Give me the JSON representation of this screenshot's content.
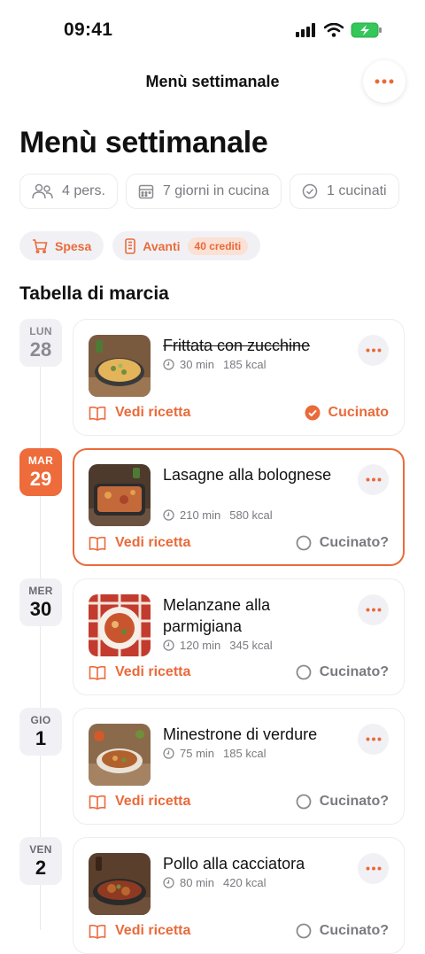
{
  "status_bar": {
    "time": "09:41"
  },
  "nav": {
    "title": "Menù settimanale"
  },
  "page": {
    "title": "Menù settimanale"
  },
  "chips": [
    {
      "label": "4 pers.",
      "icon": "people-icon"
    },
    {
      "label": "7 giorni in cucina",
      "icon": "calendar-icon"
    },
    {
      "label": "1 cucinati",
      "icon": "check-circle-icon"
    }
  ],
  "actions": {
    "shopping_label": "Spesa",
    "next_label": "Avanti",
    "credits_label": "40 crediti"
  },
  "section": {
    "title": "Tabella di marcia"
  },
  "days": [
    {
      "weekday": "LUN",
      "day": "28",
      "title": "Frittata con zucchine",
      "time": "30 min",
      "kcal": "185 kcal",
      "recipe_label": "Vedi ricetta",
      "status_label": "Cucinato",
      "cooked": true
    },
    {
      "weekday": "MAR",
      "day": "29",
      "title": "Lasagne alla bolognese",
      "time": "210 min",
      "kcal": "580 kcal",
      "recipe_label": "Vedi ricetta",
      "status_label": "Cucinato?",
      "cooked": false
    },
    {
      "weekday": "MER",
      "day": "30",
      "title": "Melanzane alla parmigiana",
      "time": "120 min",
      "kcal": "345 kcal",
      "recipe_label": "Vedi ricetta",
      "status_label": "Cucinato?",
      "cooked": false
    },
    {
      "weekday": "GIO",
      "day": "1",
      "title": "Minestrone di verdure",
      "time": "75 min",
      "kcal": "185 kcal",
      "recipe_label": "Vedi ricetta",
      "status_label": "Cucinato?",
      "cooked": false
    },
    {
      "weekday": "VEN",
      "day": "2",
      "title": "Pollo alla cacciatora",
      "time": "80 min",
      "kcal": "420 kcal",
      "recipe_label": "Vedi ricetta",
      "status_label": "Cucinato?",
      "cooked": false
    }
  ],
  "colors": {
    "accent": "#EA6A3A",
    "muted": "#7A7A80",
    "badge_bg": "#F1F1F5"
  }
}
